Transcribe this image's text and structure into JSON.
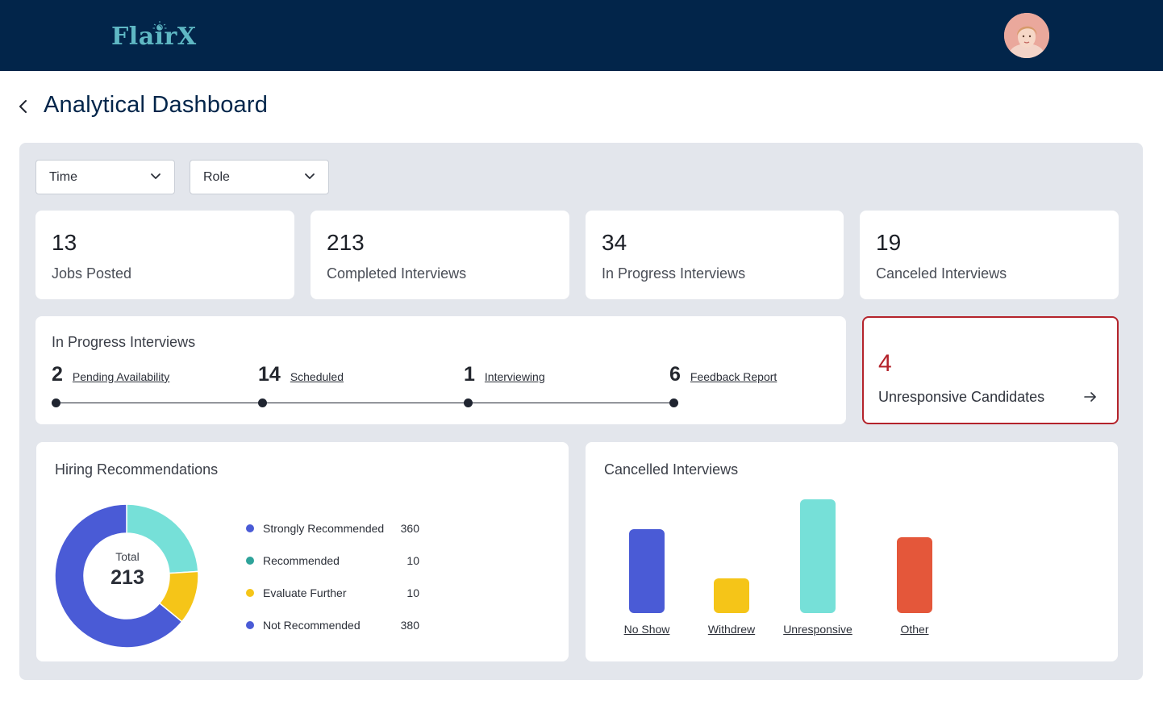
{
  "app": {
    "brand": "FlairX"
  },
  "header": {
    "title": "Analytical Dashboard"
  },
  "filters": {
    "time_label": "Time",
    "role_label": "Role"
  },
  "stats": [
    {
      "value": "13",
      "label": "Jobs Posted"
    },
    {
      "value": "213",
      "label": "Completed Interviews"
    },
    {
      "value": "34",
      "label": "In Progress Interviews"
    },
    {
      "value": "19",
      "label": "Canceled Interviews"
    }
  ],
  "in_progress": {
    "title": "In Progress Interviews",
    "steps": [
      {
        "count": "2",
        "label": "Pending Availability"
      },
      {
        "count": "14",
        "label": "Scheduled"
      },
      {
        "count": "1",
        "label": "Interviewing"
      },
      {
        "count": "6",
        "label": "Feedback Report"
      }
    ]
  },
  "unresponsive": {
    "count": "4",
    "label": "Unresponsive Candidates"
  },
  "hiring": {
    "title": "Hiring Recommendations",
    "total_label": "Total",
    "total_value": "213",
    "legend": [
      {
        "label": "Strongly Recommended",
        "value": "360",
        "color": "#4a5bd6"
      },
      {
        "label": "Recommended",
        "value": "10",
        "color": "#2ea39a"
      },
      {
        "label": "Evaluate Further",
        "value": "10",
        "color": "#f5c518"
      },
      {
        "label": "Not Recommended",
        "value": "380",
        "color": "#4a5bd6"
      }
    ],
    "donut_segments": [
      {
        "name": "teal",
        "fraction": 0.24,
        "color": "#76e0d8"
      },
      {
        "name": "yellow",
        "fraction": 0.12,
        "color": "#f5c518"
      },
      {
        "name": "blue",
        "fraction": 0.64,
        "color": "#4a5bd6"
      }
    ]
  },
  "chart_data": {
    "type": "bar",
    "title": "Cancelled Interviews",
    "categories": [
      "No Show",
      "Withdrew",
      "Unresponsive",
      "Other"
    ],
    "values": [
      104,
      43,
      141,
      94
    ],
    "colors": [
      "#4a5bd6",
      "#f5c518",
      "#76e0d8",
      "#e4573a"
    ]
  }
}
